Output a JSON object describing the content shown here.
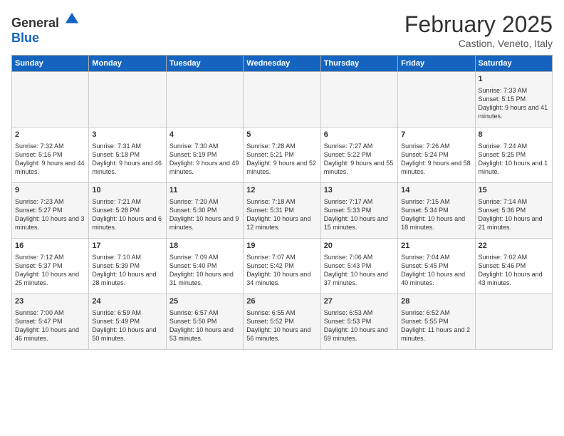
{
  "header": {
    "logo": {
      "general": "General",
      "blue": "Blue"
    },
    "title": "February 2025",
    "subtitle": "Castion, Veneto, Italy"
  },
  "days_of_week": [
    "Sunday",
    "Monday",
    "Tuesday",
    "Wednesday",
    "Thursday",
    "Friday",
    "Saturday"
  ],
  "weeks": [
    [
      {
        "day": "",
        "info": ""
      },
      {
        "day": "",
        "info": ""
      },
      {
        "day": "",
        "info": ""
      },
      {
        "day": "",
        "info": ""
      },
      {
        "day": "",
        "info": ""
      },
      {
        "day": "",
        "info": ""
      },
      {
        "day": "1",
        "info": "Sunrise: 7:33 AM\nSunset: 5:15 PM\nDaylight: 9 hours and 41 minutes."
      }
    ],
    [
      {
        "day": "2",
        "info": "Sunrise: 7:32 AM\nSunset: 5:16 PM\nDaylight: 9 hours and 44 minutes."
      },
      {
        "day": "3",
        "info": "Sunrise: 7:31 AM\nSunset: 5:18 PM\nDaylight: 9 hours and 46 minutes."
      },
      {
        "day": "4",
        "info": "Sunrise: 7:30 AM\nSunset: 5:19 PM\nDaylight: 9 hours and 49 minutes."
      },
      {
        "day": "5",
        "info": "Sunrise: 7:28 AM\nSunset: 5:21 PM\nDaylight: 9 hours and 52 minutes."
      },
      {
        "day": "6",
        "info": "Sunrise: 7:27 AM\nSunset: 5:22 PM\nDaylight: 9 hours and 55 minutes."
      },
      {
        "day": "7",
        "info": "Sunrise: 7:26 AM\nSunset: 5:24 PM\nDaylight: 9 hours and 58 minutes."
      },
      {
        "day": "8",
        "info": "Sunrise: 7:24 AM\nSunset: 5:25 PM\nDaylight: 10 hours and 1 minute."
      }
    ],
    [
      {
        "day": "9",
        "info": "Sunrise: 7:23 AM\nSunset: 5:27 PM\nDaylight: 10 hours and 3 minutes."
      },
      {
        "day": "10",
        "info": "Sunrise: 7:21 AM\nSunset: 5:28 PM\nDaylight: 10 hours and 6 minutes."
      },
      {
        "day": "11",
        "info": "Sunrise: 7:20 AM\nSunset: 5:30 PM\nDaylight: 10 hours and 9 minutes."
      },
      {
        "day": "12",
        "info": "Sunrise: 7:18 AM\nSunset: 5:31 PM\nDaylight: 10 hours and 12 minutes."
      },
      {
        "day": "13",
        "info": "Sunrise: 7:17 AM\nSunset: 5:33 PM\nDaylight: 10 hours and 15 minutes."
      },
      {
        "day": "14",
        "info": "Sunrise: 7:15 AM\nSunset: 5:34 PM\nDaylight: 10 hours and 18 minutes."
      },
      {
        "day": "15",
        "info": "Sunrise: 7:14 AM\nSunset: 5:36 PM\nDaylight: 10 hours and 21 minutes."
      }
    ],
    [
      {
        "day": "16",
        "info": "Sunrise: 7:12 AM\nSunset: 5:37 PM\nDaylight: 10 hours and 25 minutes."
      },
      {
        "day": "17",
        "info": "Sunrise: 7:10 AM\nSunset: 5:39 PM\nDaylight: 10 hours and 28 minutes."
      },
      {
        "day": "18",
        "info": "Sunrise: 7:09 AM\nSunset: 5:40 PM\nDaylight: 10 hours and 31 minutes."
      },
      {
        "day": "19",
        "info": "Sunrise: 7:07 AM\nSunset: 5:42 PM\nDaylight: 10 hours and 34 minutes."
      },
      {
        "day": "20",
        "info": "Sunrise: 7:06 AM\nSunset: 5:43 PM\nDaylight: 10 hours and 37 minutes."
      },
      {
        "day": "21",
        "info": "Sunrise: 7:04 AM\nSunset: 5:45 PM\nDaylight: 10 hours and 40 minutes."
      },
      {
        "day": "22",
        "info": "Sunrise: 7:02 AM\nSunset: 5:46 PM\nDaylight: 10 hours and 43 minutes."
      }
    ],
    [
      {
        "day": "23",
        "info": "Sunrise: 7:00 AM\nSunset: 5:47 PM\nDaylight: 10 hours and 46 minutes."
      },
      {
        "day": "24",
        "info": "Sunrise: 6:59 AM\nSunset: 5:49 PM\nDaylight: 10 hours and 50 minutes."
      },
      {
        "day": "25",
        "info": "Sunrise: 6:57 AM\nSunset: 5:50 PM\nDaylight: 10 hours and 53 minutes."
      },
      {
        "day": "26",
        "info": "Sunrise: 6:55 AM\nSunset: 5:52 PM\nDaylight: 10 hours and 56 minutes."
      },
      {
        "day": "27",
        "info": "Sunrise: 6:53 AM\nSunset: 5:53 PM\nDaylight: 10 hours and 59 minutes."
      },
      {
        "day": "28",
        "info": "Sunrise: 6:52 AM\nSunset: 5:55 PM\nDaylight: 11 hours and 2 minutes."
      },
      {
        "day": "",
        "info": ""
      }
    ]
  ]
}
